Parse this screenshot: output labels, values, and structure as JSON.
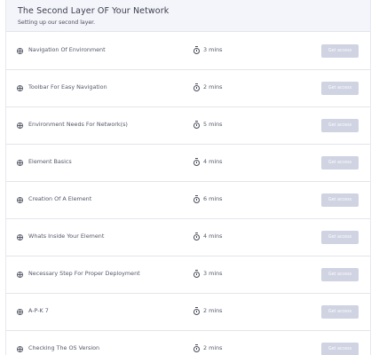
{
  "section": {
    "title": "The Second Layer OF Your Network",
    "subtitle": "Setting up our second layer."
  },
  "lessons": [
    {
      "title": "Navigation Of Environment",
      "duration": "3 mins",
      "button_label": "Get access"
    },
    {
      "title": "Toolbar For Easy Navigation",
      "duration": "2 mins",
      "button_label": "Get access"
    },
    {
      "title": "Environment Needs For Network(s)",
      "duration": "5 mins",
      "button_label": "Get access"
    },
    {
      "title": "Element Basics",
      "duration": "4 mins",
      "button_label": "Get access"
    },
    {
      "title": "Creation Of A Element",
      "duration": "6 mins",
      "button_label": "Get access"
    },
    {
      "title": "Whats Inside Your Element",
      "duration": "4 mins",
      "button_label": "Get access"
    },
    {
      "title": "Necessary Step For Proper Deployment",
      "duration": "3 mins",
      "button_label": "Get access"
    },
    {
      "title": "A-P-K 7",
      "duration": "2 mins",
      "button_label": "Get access"
    },
    {
      "title": "Checking The OS Version",
      "duration": "2 mins",
      "button_label": "Get access"
    }
  ],
  "colors": {
    "header_background": "#f4f5fa",
    "button_disabled": "#cfd3e2",
    "divider": "#e3e5ec"
  },
  "icons": {
    "lesson": "plus-circle-icon",
    "duration": "stopwatch-icon"
  }
}
